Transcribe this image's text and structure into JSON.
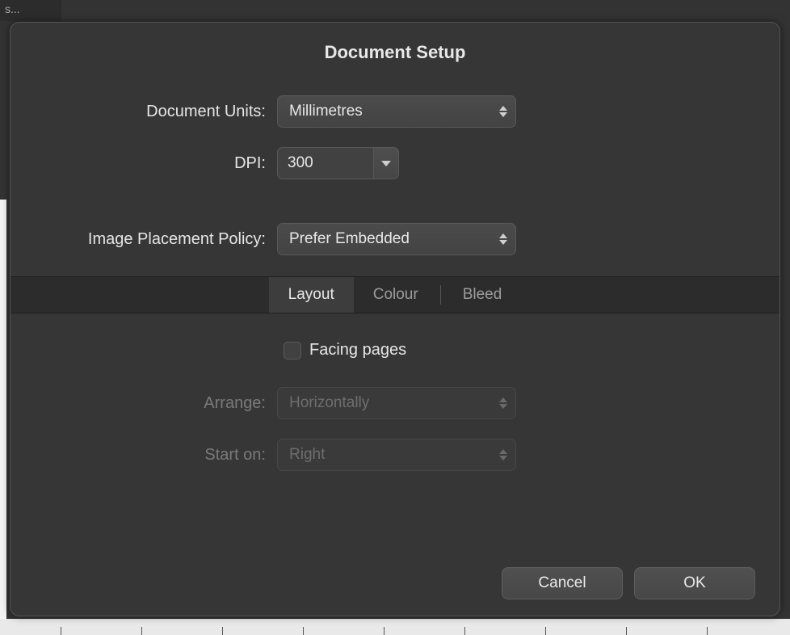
{
  "bg_tab_text": "s...",
  "dialog": {
    "title": "Document Setup",
    "labels": {
      "document_units": "Document Units:",
      "dpi": "DPI:",
      "image_placement": "Image Placement Policy:",
      "arrange": "Arrange:",
      "start_on": "Start on:",
      "facing_pages": "Facing pages"
    },
    "values": {
      "document_units": "Millimetres",
      "dpi": "300",
      "image_placement": "Prefer Embedded",
      "arrange": "Horizontally",
      "start_on": "Right",
      "facing_pages_checked": false
    },
    "tabs": {
      "layout": "Layout",
      "colour": "Colour",
      "bleed": "Bleed",
      "active": "layout"
    },
    "buttons": {
      "cancel": "Cancel",
      "ok": "OK"
    }
  }
}
